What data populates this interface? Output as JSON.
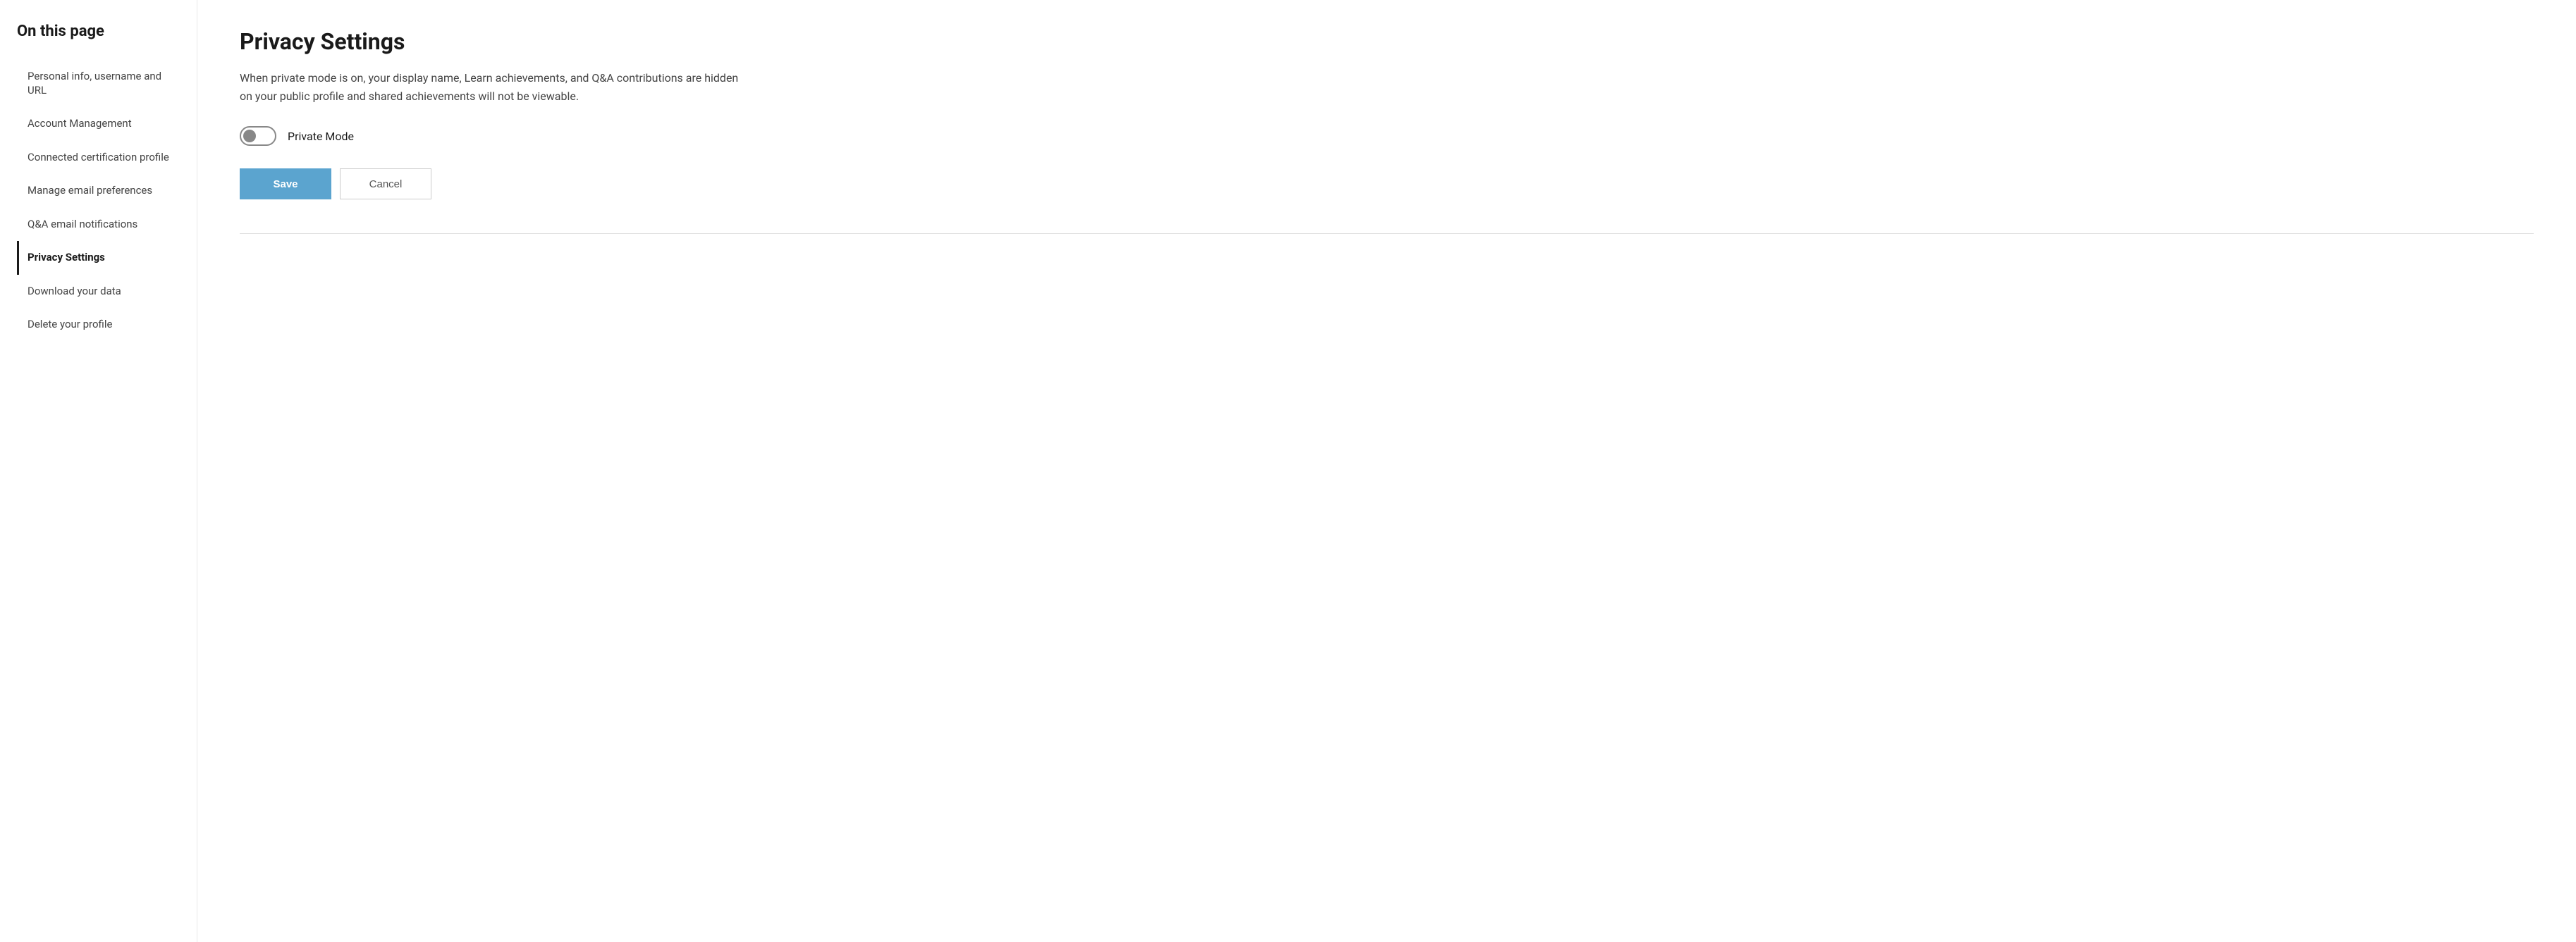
{
  "sidebar": {
    "heading": "On this page",
    "items": [
      {
        "id": "personal-info",
        "label": "Personal info, username and URL",
        "active": false
      },
      {
        "id": "account-management",
        "label": "Account Management",
        "active": false
      },
      {
        "id": "connected-cert",
        "label": "Connected certification profile",
        "active": false
      },
      {
        "id": "manage-email",
        "label": "Manage email preferences",
        "active": false
      },
      {
        "id": "qa-email",
        "label": "Q&A email notifications",
        "active": false
      },
      {
        "id": "privacy-settings",
        "label": "Privacy Settings",
        "active": true
      },
      {
        "id": "download-data",
        "label": "Download your data",
        "active": false
      },
      {
        "id": "delete-profile",
        "label": "Delete your profile",
        "active": false
      }
    ]
  },
  "main": {
    "section_title": "Privacy Settings",
    "description": "When private mode is on, your display name, Learn achievements, and Q&A contributions are hidden on your public profile and shared achievements will not be viewable.",
    "toggle_label": "Private Mode",
    "toggle_state": false,
    "save_label": "Save",
    "cancel_label": "Cancel"
  }
}
